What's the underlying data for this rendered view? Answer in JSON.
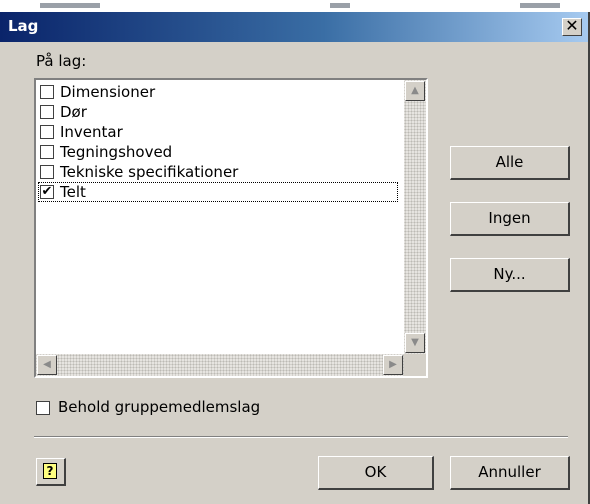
{
  "dialog": {
    "title": "Lag",
    "close_glyph": "✕",
    "layers_label": "På lag:"
  },
  "layers": [
    {
      "label": "Dimensioner",
      "checked": false
    },
    {
      "label": "Dør",
      "checked": false
    },
    {
      "label": "Inventar",
      "checked": false
    },
    {
      "label": "Tegningshoved",
      "checked": false
    },
    {
      "label": "Tekniske specifikationer",
      "checked": false
    },
    {
      "label": "Telt",
      "checked": true
    }
  ],
  "scroll_glyphs": {
    "up": "▲",
    "down": "▼",
    "left": "◀",
    "right": "▶"
  },
  "buttons": {
    "all": "Alle",
    "none": "Ingen",
    "new": "Ny...",
    "ok": "OK",
    "cancel": "Annuller"
  },
  "keep_group": {
    "label": "Behold gruppemedlemslag",
    "checked": false
  },
  "help": {
    "glyph": "?",
    "icon": "help-icon"
  },
  "colors": {
    "titlebar_start": "#0a246a",
    "titlebar_end": "#a6caf0",
    "face": "#d4d0c8"
  }
}
